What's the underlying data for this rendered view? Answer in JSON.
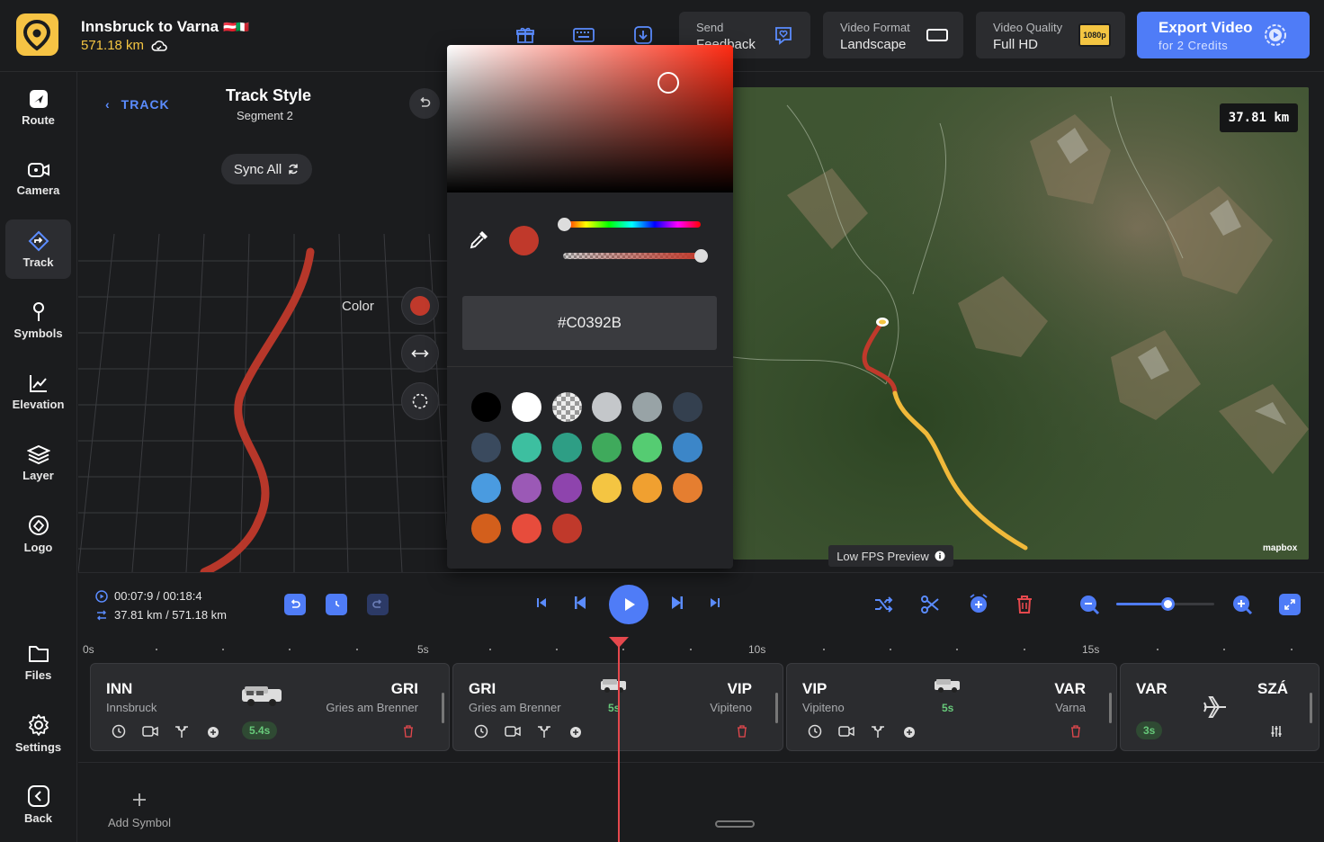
{
  "project": {
    "title": "Innsbruck to Varna",
    "flags": "🇦🇹🇮🇹",
    "distance": "571.18 km"
  },
  "topbar": {
    "feedback": {
      "line1": "Send",
      "line2": "Feedback"
    },
    "video_format": {
      "label": "Video Format",
      "value": "Landscape"
    },
    "video_quality": {
      "label": "Video Quality",
      "value": "Full HD",
      "badge": "1080p"
    },
    "export": {
      "label": "Export Video",
      "sub": "for 2 Credits"
    }
  },
  "sidebar": {
    "items": [
      {
        "label": "Route"
      },
      {
        "label": "Camera"
      },
      {
        "label": "Track"
      },
      {
        "label": "Symbols"
      },
      {
        "label": "Elevation"
      },
      {
        "label": "Layer"
      },
      {
        "label": "Logo"
      },
      {
        "label": "Files"
      },
      {
        "label": "Settings"
      },
      {
        "label": "Back"
      }
    ],
    "active": "Track"
  },
  "panel": {
    "back_label": "TRACK",
    "title": "Track Style",
    "subtitle": "Segment 2",
    "sync_label": "Sync All",
    "color_label": "Color",
    "track_color": "#c0392b"
  },
  "picker": {
    "hex": "#C0392B",
    "palette": [
      "#000000",
      "#ffffff",
      "transparent",
      "#c4c7ca",
      "#98a3a6",
      "#34404f",
      "#3a4a5e",
      "#3dbfa0",
      "#2e9e85",
      "#3faa5c",
      "#55cc72",
      "#3c86c8",
      "#4a9be0",
      "#9b59b6",
      "#8e44ad",
      "#f4c542",
      "#f0a030",
      "#e57e30",
      "#d35f1c",
      "#e74c3c",
      "#c0392b"
    ]
  },
  "map": {
    "distance_badge": "37.81 km",
    "fps_label": "Low FPS Preview",
    "attribution": "mapbox",
    "track_done_color": "#c0392b",
    "track_rest_color": "#f0b93a"
  },
  "transport": {
    "time": "00:07:9 / 00:18:4",
    "distance": "37.81 km / 571.18 km"
  },
  "timeline": {
    "ticks": [
      "0s",
      "5s",
      "10s",
      "15s"
    ],
    "segments": [
      {
        "from_code": "INN",
        "from_name": "Innsbruck",
        "to_code": "GRI",
        "to_name": "Gries am Brenner",
        "duration": "5.4s",
        "mode": "car"
      },
      {
        "from_code": "GRI",
        "from_name": "Gries am Brenner",
        "to_code": "VIP",
        "to_name": "Vipiteno",
        "duration": "5s",
        "mode": "car"
      },
      {
        "from_code": "VIP",
        "from_name": "Vipiteno",
        "to_code": "VAR",
        "to_name": "Varna",
        "duration": "5s",
        "mode": "car"
      },
      {
        "from_code": "VAR",
        "from_name": "",
        "to_code": "SZÁ",
        "to_name": "",
        "duration": "3s",
        "mode": "plane"
      }
    ],
    "add_symbol_label": "Add Symbol"
  }
}
